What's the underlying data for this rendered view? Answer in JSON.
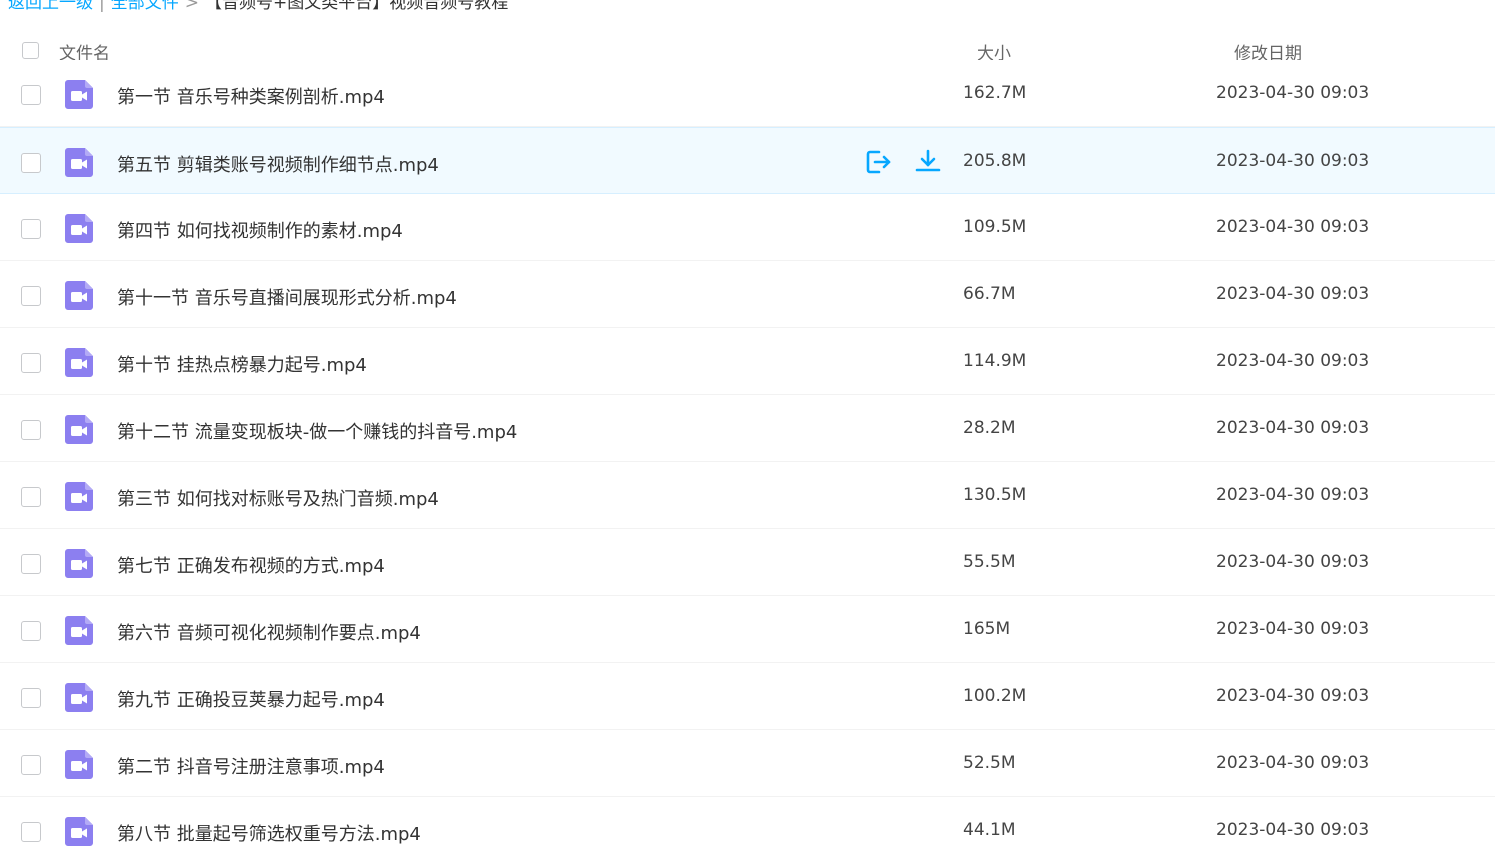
{
  "breadcrumb": {
    "items": [
      "返回上一级",
      "全部文件",
      "【音频号+图文类平台】视频音频号教程"
    ]
  },
  "header": {
    "name_label": "文件名",
    "size_label": "大小",
    "date_label": "修改日期"
  },
  "colors": {
    "accent": "#06a7ff",
    "video_icon": "#8c7ff0",
    "hover_bg": "#f1faff"
  },
  "rows": [
    {
      "name": "第一节 音乐号种类案例剖析.mp4",
      "size": "162.7M",
      "date": "2023-04-30 09:03",
      "icon": "video-file-icon"
    },
    {
      "name": "第五节 剪辑类账号视频制作细节点.mp4",
      "size": "205.8M",
      "date": "2023-04-30 09:03",
      "icon": "video-file-icon",
      "hovered": true
    },
    {
      "name": "第四节 如何找视频制作的素材.mp4",
      "size": "109.5M",
      "date": "2023-04-30 09:03",
      "icon": "video-file-icon"
    },
    {
      "name": "第十一节 音乐号直播间展现形式分析.mp4",
      "size": "66.7M",
      "date": "2023-04-30 09:03",
      "icon": "video-file-icon"
    },
    {
      "name": "第十节 挂热点榜暴力起号.mp4",
      "size": "114.9M",
      "date": "2023-04-30 09:03",
      "icon": "video-file-icon"
    },
    {
      "name": "第十二节 流量变现板块-做一个赚钱的抖音号.mp4",
      "size": "28.2M",
      "date": "2023-04-30 09:03",
      "icon": "video-file-icon"
    },
    {
      "name": "第三节 如何找对标账号及热门音频.mp4",
      "size": "130.5M",
      "date": "2023-04-30 09:03",
      "icon": "video-file-icon"
    },
    {
      "name": "第七节 正确发布视频的方式.mp4",
      "size": "55.5M",
      "date": "2023-04-30 09:03",
      "icon": "video-file-icon"
    },
    {
      "name": "第六节 音频可视化视频制作要点.mp4",
      "size": "165M",
      "date": "2023-04-30 09:03",
      "icon": "video-file-icon"
    },
    {
      "name": "第九节 正确投豆荚暴力起号.mp4",
      "size": "100.2M",
      "date": "2023-04-30 09:03",
      "icon": "video-file-icon"
    },
    {
      "name": "第二节 抖音号注册注意事项.mp4",
      "size": "52.5M",
      "date": "2023-04-30 09:03",
      "icon": "video-file-icon"
    },
    {
      "name": "第八节 批量起号筛选权重号方法.mp4",
      "size": "44.1M",
      "date": "2023-04-30 09:03",
      "icon": "video-file-icon"
    }
  ],
  "row_actions": [
    {
      "icon": "share-icon"
    },
    {
      "icon": "download-icon"
    }
  ]
}
